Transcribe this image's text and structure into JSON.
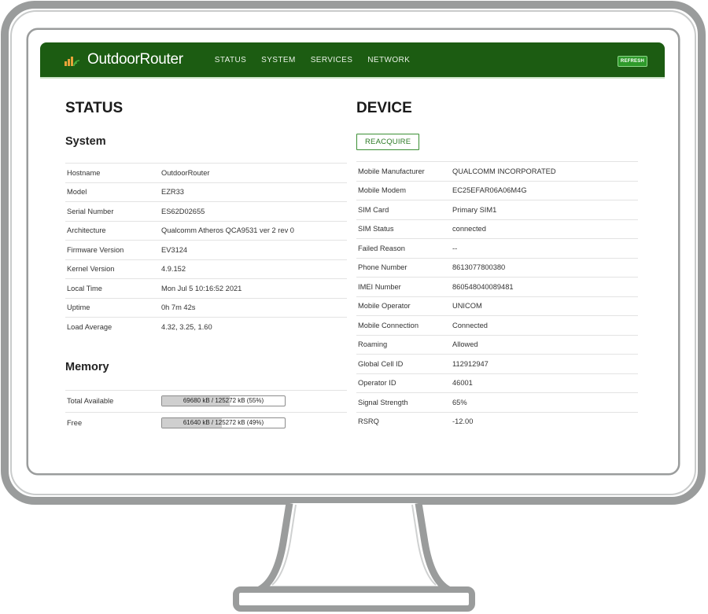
{
  "app": {
    "brand": "OutdoorRouter",
    "nav": [
      "STATUS",
      "SYSTEM",
      "SERVICES",
      "NETWORK"
    ],
    "refresh_label": "REFRESH"
  },
  "status": {
    "title": "STATUS",
    "system_title": "System",
    "system_rows": [
      {
        "label": "Hostname",
        "value": "OutdoorRouter"
      },
      {
        "label": "Model",
        "value": "EZR33"
      },
      {
        "label": "Serial Number",
        "value": "ES62D02655"
      },
      {
        "label": "Architecture",
        "value": "Qualcomm Atheros QCA9531 ver 2 rev 0"
      },
      {
        "label": "Firmware Version",
        "value": "EV3124"
      },
      {
        "label": "Kernel Version",
        "value": "4.9.152"
      },
      {
        "label": "Local Time",
        "value": "Mon Jul 5 10:16:52 2021"
      },
      {
        "label": "Uptime",
        "value": "0h 7m 42s"
      },
      {
        "label": "Load Average",
        "value": "4.32, 3.25, 1.60"
      }
    ],
    "memory_title": "Memory",
    "memory_rows": [
      {
        "label": "Total Available",
        "text": "69680 kB / 125272 kB (55%)",
        "fraction": 0.55
      },
      {
        "label": "Free",
        "text": "61640 kB / 125272 kB (49%)",
        "fraction": 0.49
      }
    ]
  },
  "device": {
    "title": "DEVICE",
    "reacquire_label": "REACQUIRE",
    "rows": [
      {
        "label": "Mobile Manufacturer",
        "value": "QUALCOMM INCORPORATED"
      },
      {
        "label": "Mobile Modem",
        "value": "EC25EFAR06A06M4G"
      },
      {
        "label": "SIM Card",
        "value": "Primary SIM1"
      },
      {
        "label": "SIM Status",
        "value": "connected"
      },
      {
        "label": "Failed Reason",
        "value": "--"
      },
      {
        "label": "Phone Number",
        "value": "8613077800380"
      },
      {
        "label": "IMEI Number",
        "value": "860548040089481"
      },
      {
        "label": "Mobile Operator",
        "value": "UNICOM"
      },
      {
        "label": "Mobile Connection",
        "value": "Connected"
      },
      {
        "label": "Roaming",
        "value": "Allowed"
      },
      {
        "label": "Global Cell ID",
        "value": "112912947"
      },
      {
        "label": "Operator ID",
        "value": "46001"
      },
      {
        "label": "Signal Strength",
        "value": "65%"
      },
      {
        "label": "RSRQ",
        "value": "-12.00"
      }
    ]
  },
  "colors": {
    "navbar": "#1c5c12",
    "accent": "#2e9a2a",
    "signal_icon": "#e8a33a",
    "monitor_frame": "#9a9c9c"
  },
  "icons": {
    "brand": "signal-bars-icon"
  }
}
